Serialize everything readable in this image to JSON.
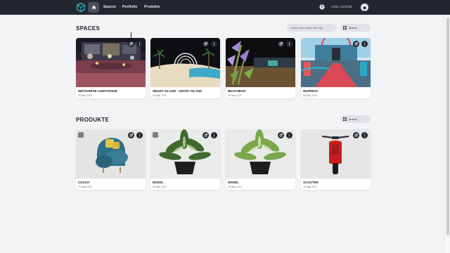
{
  "nav": {
    "links": [
      "Spaces",
      "Portfolio",
      "Produkte"
    ],
    "user_name": "Armin Schmidt",
    "icons": {
      "logo": "cube-logo-icon",
      "home": "home-icon",
      "help": "help-icon",
      "avatar": "user-avatar-icon"
    }
  },
  "spaces": {
    "title": "SPACES",
    "search_placeholder": "Suche nach Name oder Tag",
    "filter_label": "Ansicht",
    "items": [
      {
        "title": "METAVERSE AUDITORIUM",
        "date": "09 May 2023"
      },
      {
        "title": "SMART ISLAND - SMART ISLAND",
        "date": "09 May 2023"
      },
      {
        "title": "BEACHBAR",
        "date": "09 May 2023"
      },
      {
        "title": "NUPRESS",
        "date": "09 May 2023"
      }
    ]
  },
  "products": {
    "title": "PRODUKTE",
    "filter_label": "Ansicht",
    "items": [
      {
        "title": "COUCH",
        "date": "09 May 2023"
      },
      {
        "title": "MODEL",
        "date": "09 May 2023"
      },
      {
        "title": "MODEL",
        "date": "09 May 2023"
      },
      {
        "title": "SCOOTER",
        "date": "09 May 2023"
      }
    ]
  },
  "colors": {
    "nav_bg": "#23272f",
    "page_bg": "#f2f3f5",
    "card_bg": "#ffffff",
    "button_dark": "#23272f",
    "accent_logo": "#38b6c9"
  }
}
